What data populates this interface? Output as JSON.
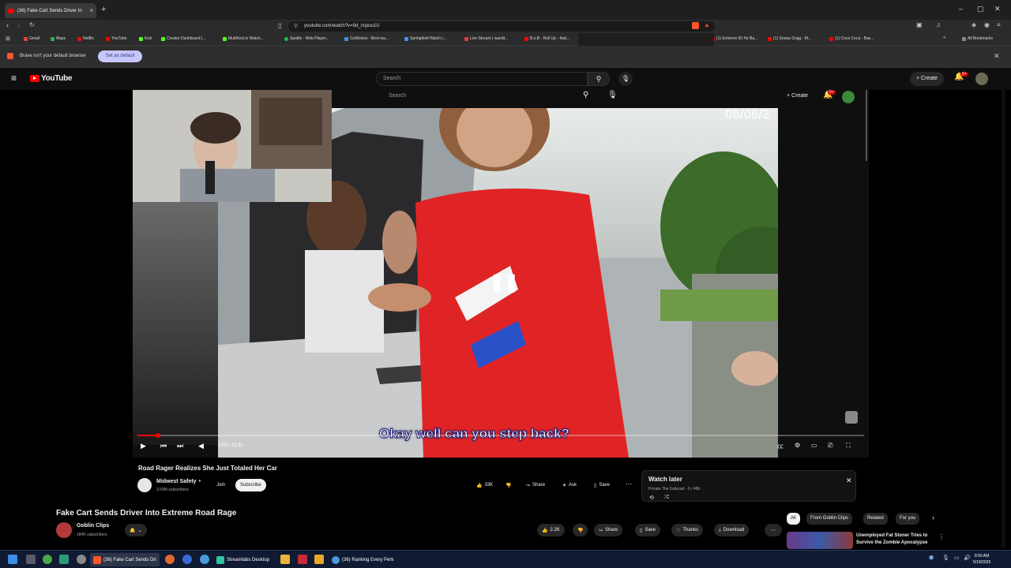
{
  "browser": {
    "tab_title": "(36) Fake Cart Sends Driver In",
    "url": "youtube.com/watch?v=9d_ricpuu1U",
    "bookmarks": [
      {
        "label": "Gmail",
        "color": "#ea4335"
      },
      {
        "label": "Maps",
        "color": "#34a853"
      },
      {
        "label": "Netflix",
        "color": "#e50914"
      },
      {
        "label": "YouTube",
        "color": "#ff0000"
      },
      {
        "label": "Kick",
        "color": "#53fc18"
      },
      {
        "label": "Creator Dashboard |...",
        "color": "#53fc18"
      },
      {
        "label": "MultiKick.tv Watch...",
        "color": "#53fc18"
      },
      {
        "label": "Spotify - Web Player...",
        "color": "#1db954"
      },
      {
        "label": "GoMovies - Best wa...",
        "color": "#4a90e2"
      },
      {
        "label": "Springfield Watch |...",
        "color": "#4a90e2"
      },
      {
        "label": "Live Stream | wandt...",
        "color": "#e53935"
      },
      {
        "label": "B.o.B - Roll Up - feat...",
        "color": "#ff0000"
      },
      {
        "label": "(1) Extreme 50 Hz Ba...",
        "color": "#ff0000"
      },
      {
        "label": "(1) Snoop Dogg - M...",
        "color": "#ff0000"
      },
      {
        "label": "(1) Coca Coca - Bas...",
        "color": "#ff0000"
      }
    ],
    "all_bookmarks": "All Bookmarks",
    "infobar_text": "Brave isn't your default browser",
    "infobar_button": "Set as default"
  },
  "youtube": {
    "logo_text": "YouTube",
    "search_placeholder": "Search",
    "create_label": "Create",
    "notif_count": "9+"
  },
  "stream": {
    "search_placeholder": "Search",
    "create_label": "Create",
    "notif_count": "9+",
    "video_date_overlay": "08/06/2",
    "subtitle": "Okay well can you step back?",
    "time": "0:05 / 13:31",
    "progress": 0.006,
    "video_title": "Road Rager Realizes She Just Totaled Her Car",
    "channel_name": "Midwest Safety",
    "channel_subs": "3.59M subscribers",
    "join_label": "Join",
    "subscribe_label": "Subscribe",
    "like_count": "33K",
    "share_label": "Share",
    "ask_label": "Ask",
    "save_label": "Save",
    "watch_later_title": "Watch later",
    "watch_later_sub": "Private The Gobcast - 9 / 486"
  },
  "main_video": {
    "title": "Fake Cart Sends Driver Into Extreme Road Rage",
    "channel_name": "Goblin Clips",
    "channel_subs": "184K subscribers",
    "like_count": "2.2K",
    "share_label": "Share",
    "save_label": "Save",
    "thanks_label": "Thanks",
    "download_label": "Download"
  },
  "chips": [
    "All",
    "From Goblin Clips",
    "Related",
    "For you"
  ],
  "suggested": {
    "title_line1": "Unemployed Fat Stoner Tries to",
    "title_line2": "Survive the Zombie Apocalypse"
  },
  "taskbar": {
    "apps": [
      "(36) Fake Cart Sends Dri",
      "Streamlabs Desktop",
      "(36) Ranking Every Perk"
    ],
    "time": "8:50 AM",
    "date": "5/18/2026"
  }
}
